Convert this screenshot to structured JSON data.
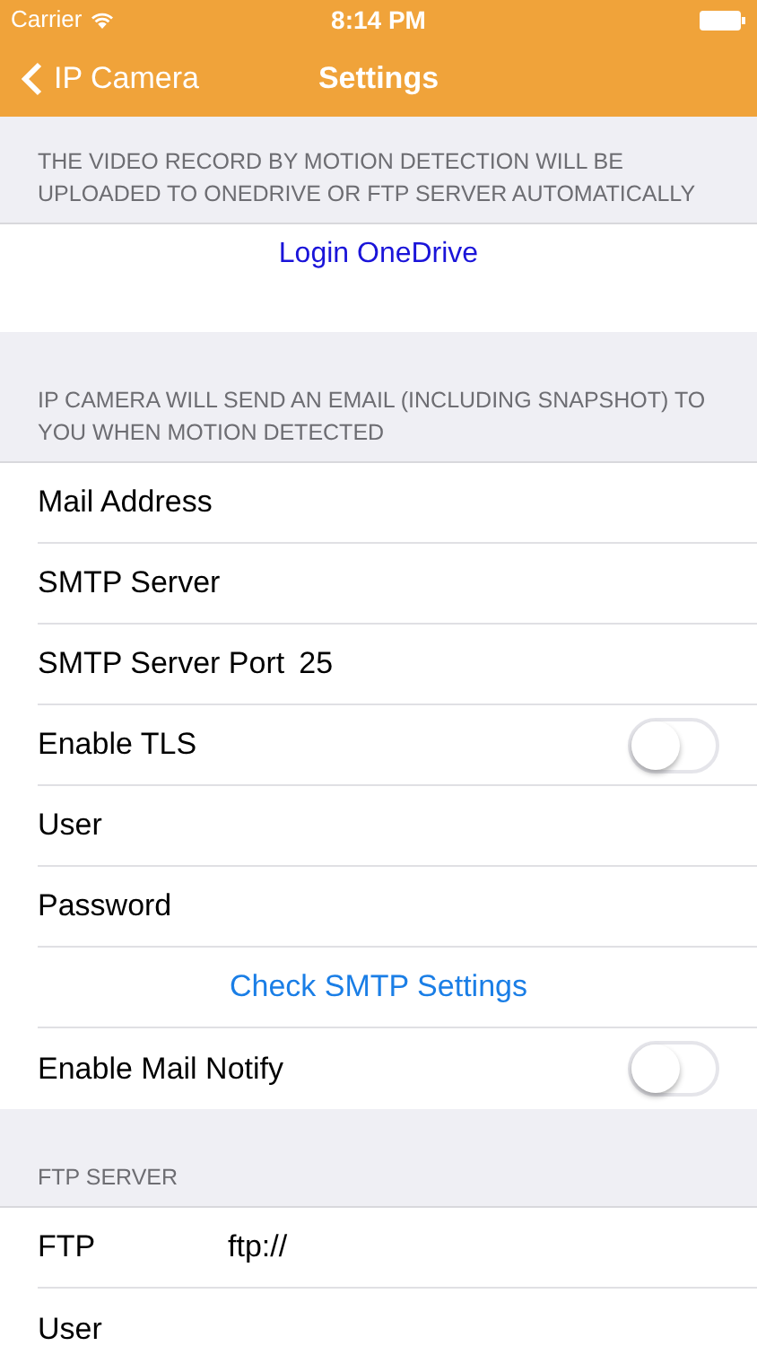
{
  "status_bar": {
    "carrier": "Carrier",
    "time": "8:14 PM"
  },
  "nav": {
    "back": "IP Camera",
    "title": "Settings"
  },
  "sections": [
    {
      "header": "THE VIDEO RECORD BY MOTION DETECTION WILL BE UPLOADED TO ONEDRIVE OR FTP SERVER AUTOMATICALLY",
      "rows": [
        {
          "kind": "login",
          "label": "Login OneDrive"
        }
      ]
    },
    {
      "header": "IP CAMERA WILL SEND AN EMAIL (INCLUDING SNAPSHOT) TO YOU WHEN MOTION DETECTED",
      "rows": [
        {
          "kind": "field",
          "label": "Mail Address"
        },
        {
          "kind": "field",
          "label": "SMTP Server"
        },
        {
          "kind": "field",
          "label": "SMTP Server Port",
          "value": "25"
        },
        {
          "kind": "toggle",
          "label": "Enable TLS",
          "on": false
        },
        {
          "kind": "field",
          "label": "User"
        },
        {
          "kind": "field",
          "label": "Password"
        },
        {
          "kind": "action",
          "label": "Check SMTP Settings"
        },
        {
          "kind": "toggle",
          "label": "Enable Mail Notify",
          "on": false
        }
      ]
    },
    {
      "header": "FTP SERVER",
      "rows": [
        {
          "kind": "field",
          "label": "FTP",
          "value": "ftp://",
          "wide": true
        },
        {
          "kind": "field",
          "label": "User"
        }
      ]
    }
  ]
}
